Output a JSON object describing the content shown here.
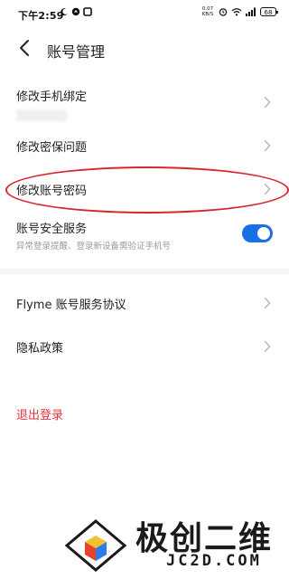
{
  "status_bar": {
    "time": "下午2:59",
    "net_speed_value": "0.07",
    "net_speed_unit": "KB/S",
    "battery": "68"
  },
  "header": {
    "title": "账号管理"
  },
  "settings": {
    "rows": [
      {
        "label": "修改手机绑定"
      },
      {
        "label": "修改密保问题"
      },
      {
        "label": "修改账号密码"
      },
      {
        "label": "账号安全服务",
        "sub": "异常登录提醒、登录新设备需验证手机号",
        "toggle_on": true
      },
      {
        "label": "Flyme 账号服务协议"
      },
      {
        "label": "隐私政策"
      }
    ],
    "logout": "退出登录"
  },
  "colors": {
    "accent": "#1a6fe6",
    "logout": "#e0353b",
    "highlight": "#d8262c"
  },
  "watermark": {
    "cn": "极创二维",
    "en": "JC2D.COM"
  }
}
